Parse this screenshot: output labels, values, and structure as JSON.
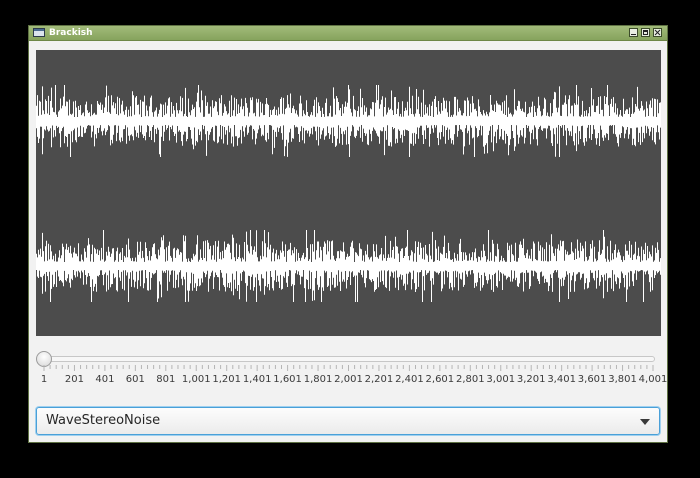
{
  "window": {
    "title": "Brackish",
    "buttons": [
      "minimize",
      "maximize",
      "close"
    ],
    "icon": "app-window-icon"
  },
  "waveform": {
    "channels": 2,
    "background": "#4c4c4c",
    "stroke": "#ffffff"
  },
  "slider": {
    "value": 1,
    "min": 1,
    "max": 4001,
    "tick_labels": [
      "1",
      "201",
      "401",
      "601",
      "801",
      "1,001",
      "1,201",
      "1,401",
      "1,601",
      "1,801",
      "2,001",
      "2,201",
      "2,401",
      "2,601",
      "2,801",
      "3,001",
      "3,201",
      "3,401",
      "3,601",
      "3,801",
      "4,001"
    ]
  },
  "source_select": {
    "value": "WaveStereoNoise"
  },
  "colors": {
    "titlebar": "#8ea766",
    "focus": "#4aa0d8"
  }
}
